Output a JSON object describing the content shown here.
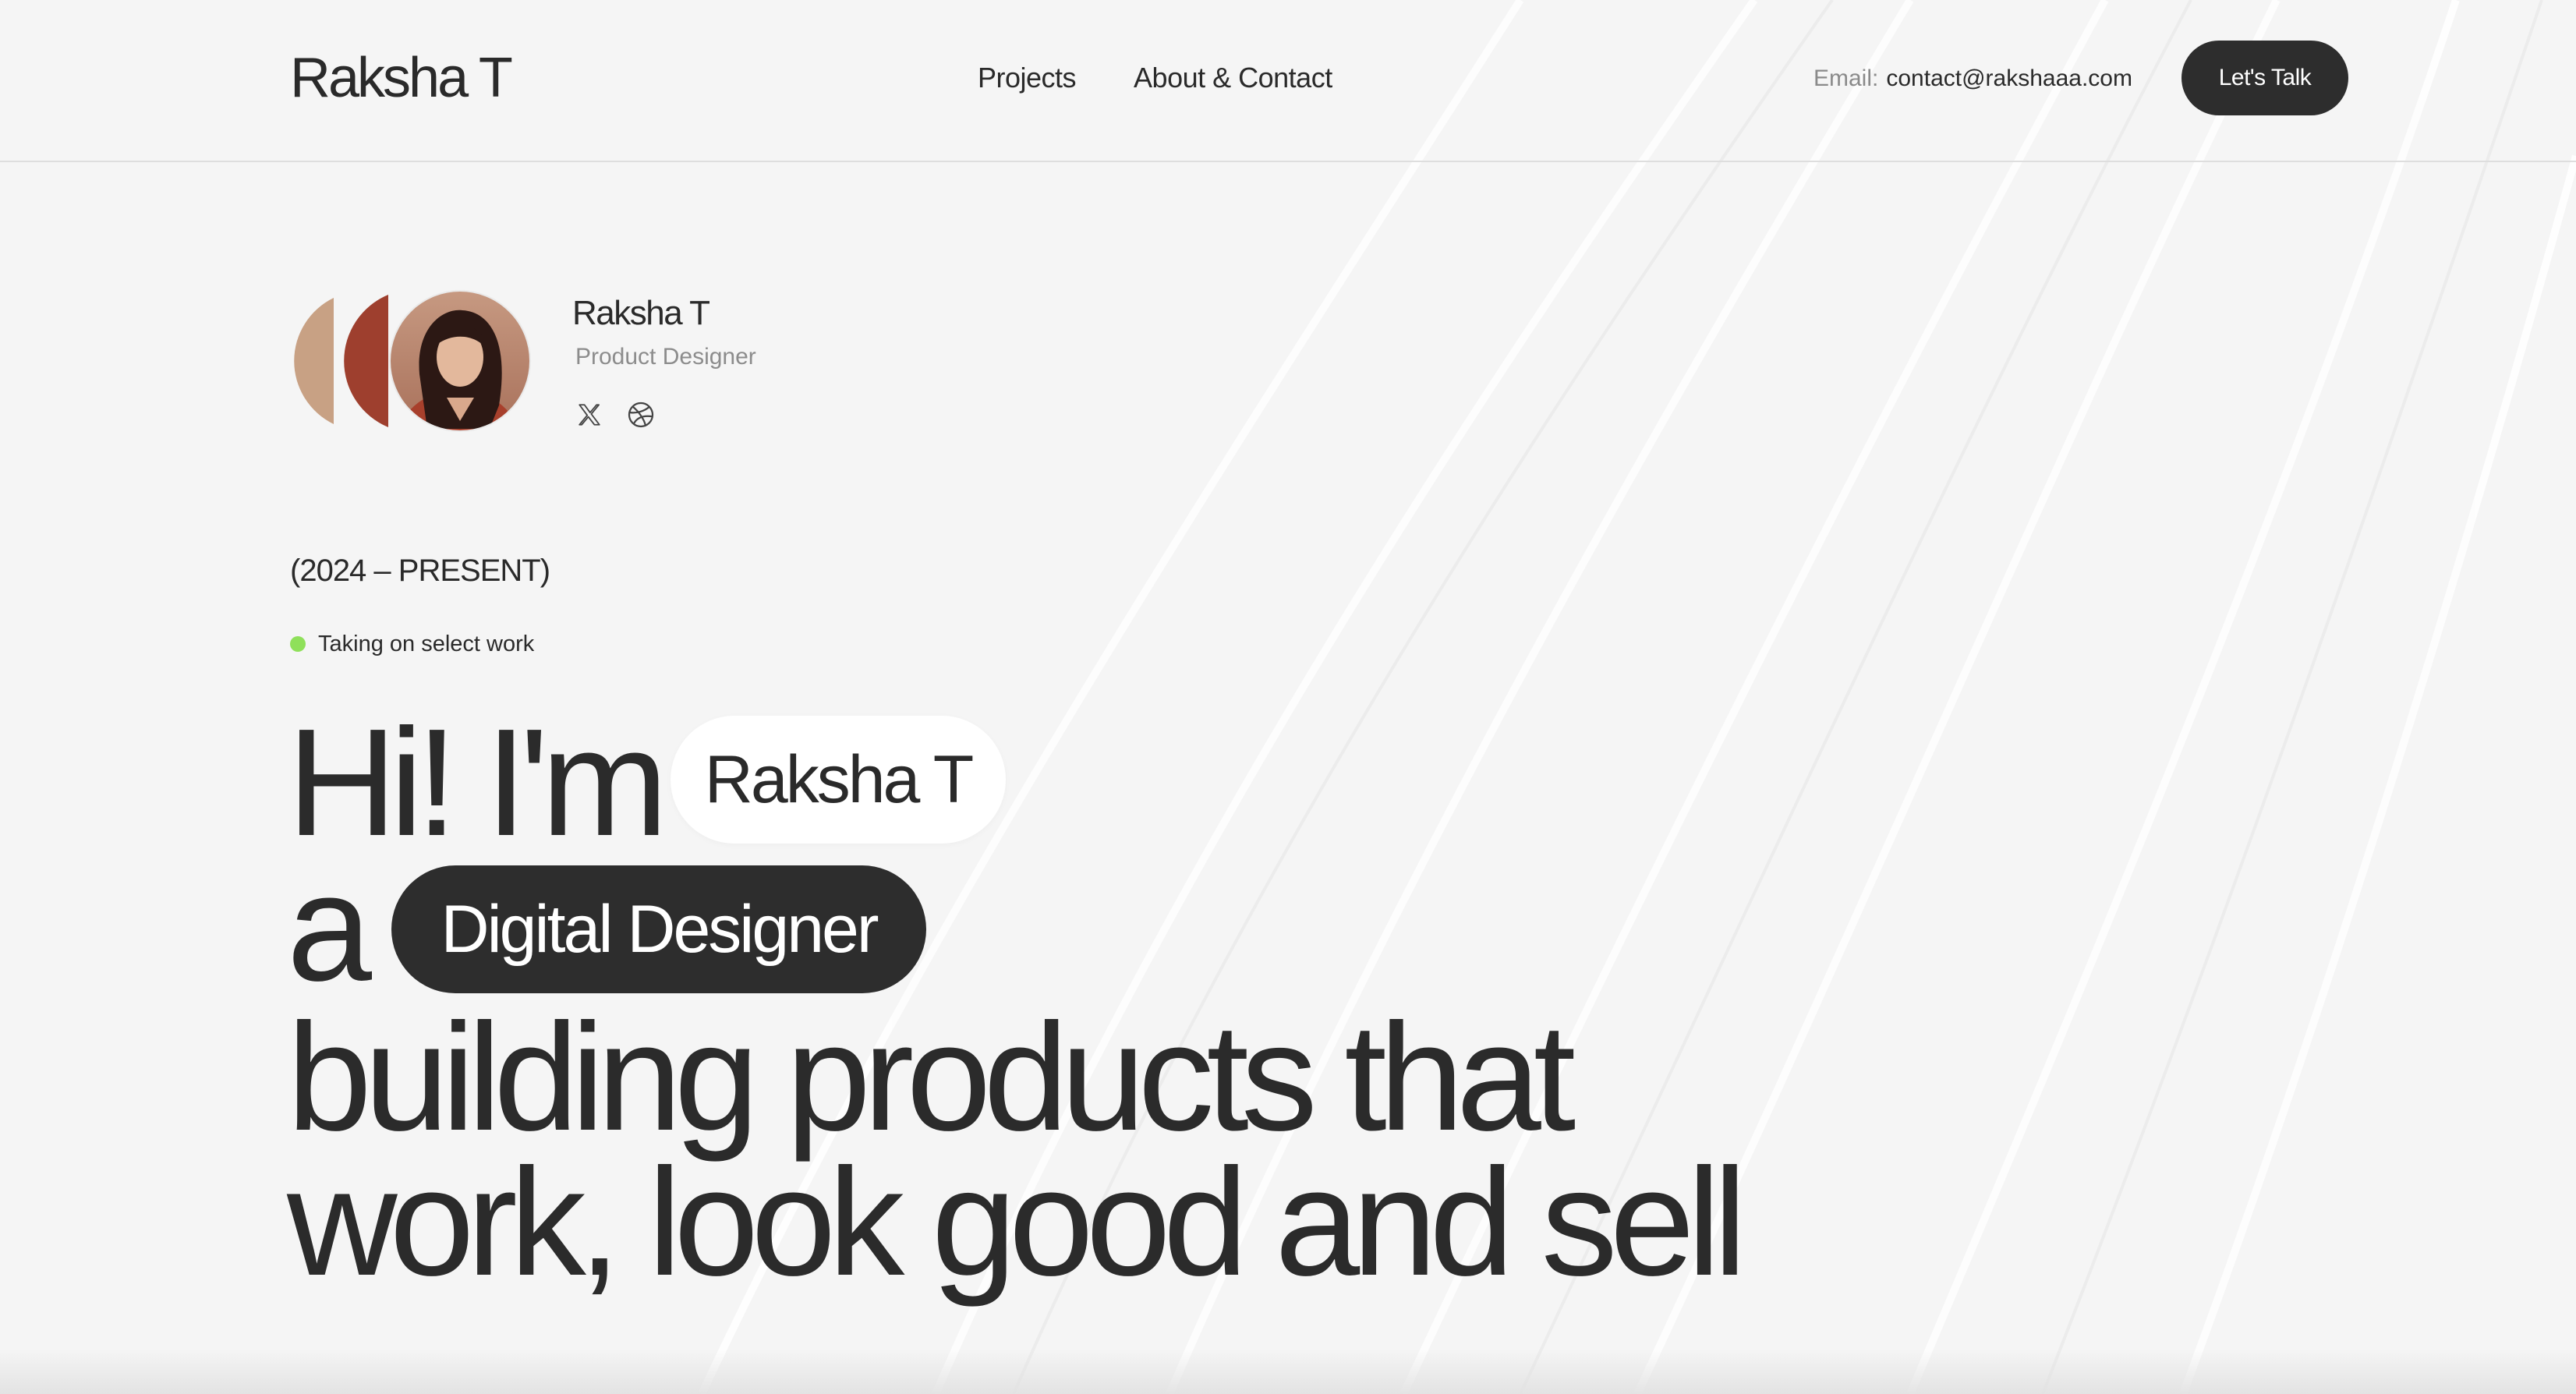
{
  "header": {
    "logo": "Raksha T",
    "nav": [
      "Projects",
      "About & Contact"
    ],
    "email_label": "Email:",
    "email_value": "contact@rakshaaa.com",
    "cta_label": "Let's Talk"
  },
  "profile": {
    "name": "Raksha T",
    "role": "Product Designer",
    "social_icons": [
      "x-icon",
      "dribbble-icon"
    ]
  },
  "period": "(2024 – PRESENT)",
  "availability": {
    "text": "Taking on select work",
    "status_color": "#8fe05a"
  },
  "hero": {
    "line1_prefix": "Hi! I'm",
    "name_pill": "Raksha T",
    "line2_prefix": "a",
    "role_pill": "Digital Designer",
    "line3": "building products that",
    "line4": "work, look good and sell"
  },
  "colors": {
    "background": "#f5f5f5",
    "dark": "#2d2d2d",
    "accent_terracotta": "#9e3f2e",
    "accent_tan": "#c8a184"
  }
}
